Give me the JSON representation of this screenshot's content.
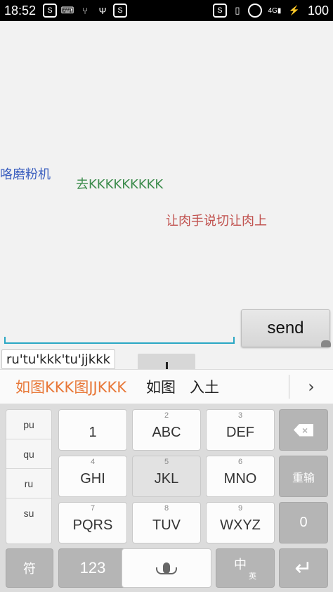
{
  "status_bar": {
    "time": "18:52",
    "left_icons": [
      "s-icon",
      "keyboard-icon",
      "usb-share-icon",
      "usb-icon",
      "s-icon"
    ],
    "right_icons": [
      "s-icon",
      "vibrate-icon",
      "alarm-icon",
      "signal-icon",
      "charging-icon"
    ],
    "network_label": "4G",
    "battery": "100"
  },
  "chat": {
    "messages": [
      {
        "text": "咯磨粉机",
        "color": "#3b5fbf"
      },
      {
        "text": "去KKKKKKKKK",
        "color": "#3c8c4c"
      },
      {
        "text": "让肉手说切让肉上",
        "color": "#c0504d"
      }
    ],
    "send_label": "send",
    "compose_text": "ru'tu'kkk'tu'jjkkk"
  },
  "candidates": {
    "items": [
      "如图KKK图JJKKK",
      "如图",
      "入土"
    ],
    "more": "›"
  },
  "keyboard": {
    "pinyin": [
      "pu",
      "qu",
      "ru",
      "su"
    ],
    "rows": [
      [
        {
          "sub": "",
          "label": "1"
        },
        {
          "sub": "2",
          "label": "ABC"
        },
        {
          "sub": "3",
          "label": "DEF"
        }
      ],
      [
        {
          "sub": "4",
          "label": "GHI"
        },
        {
          "sub": "5",
          "label": "JKL"
        },
        {
          "sub": "6",
          "label": "MNO"
        }
      ],
      [
        {
          "sub": "7",
          "label": "PQRS"
        },
        {
          "sub": "8",
          "label": "TUV"
        },
        {
          "sub": "9",
          "label": "WXYZ"
        }
      ]
    ],
    "reenter": "重输",
    "zero": "0",
    "symbols": "符",
    "numbers": "123",
    "lang_main": "中",
    "lang_sub": "英",
    "accent_color": "#e8793a"
  }
}
